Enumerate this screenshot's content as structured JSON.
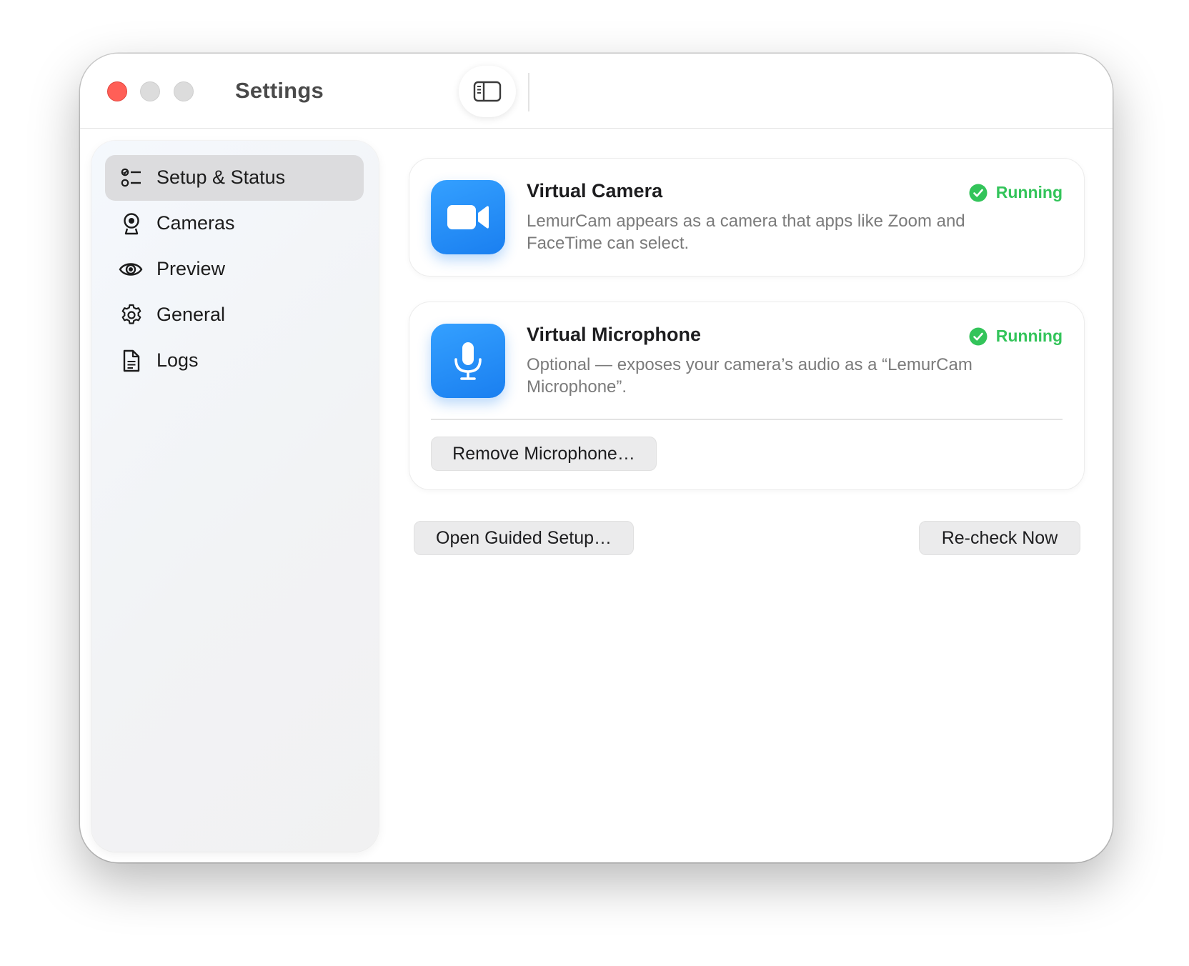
{
  "window": {
    "title": "Settings"
  },
  "toolbar": {
    "toggle_sidebar_icon": "sidebar-icon"
  },
  "sidebar": {
    "items": [
      {
        "label": "Setup & Status",
        "icon": "checklist-icon",
        "selected": true
      },
      {
        "label": "Cameras",
        "icon": "webcam-icon",
        "selected": false
      },
      {
        "label": "Preview",
        "icon": "eye-icon",
        "selected": false
      },
      {
        "label": "General",
        "icon": "gear-icon",
        "selected": false
      },
      {
        "label": "Logs",
        "icon": "document-icon",
        "selected": false
      }
    ]
  },
  "main": {
    "camera_card": {
      "icon": "video-camera-icon",
      "title": "Virtual Camera",
      "status": "Running",
      "description": "LemurCam appears as a camera that apps like Zoom and FaceTime can select."
    },
    "microphone_card": {
      "icon": "microphone-icon",
      "title": "Virtual Microphone",
      "status": "Running",
      "description": "Optional — exposes your camera’s audio as a “LemurCam Microphone”.",
      "remove_button": "Remove Microphone…"
    },
    "open_setup_button": "Open Guided Setup…",
    "recheck_button": "Re-check Now"
  },
  "colors": {
    "accent": "#1a7ff0",
    "status_running": "#33c45a",
    "close_button": "#ff5f57",
    "sidebar_selected": "#dcdcde"
  }
}
